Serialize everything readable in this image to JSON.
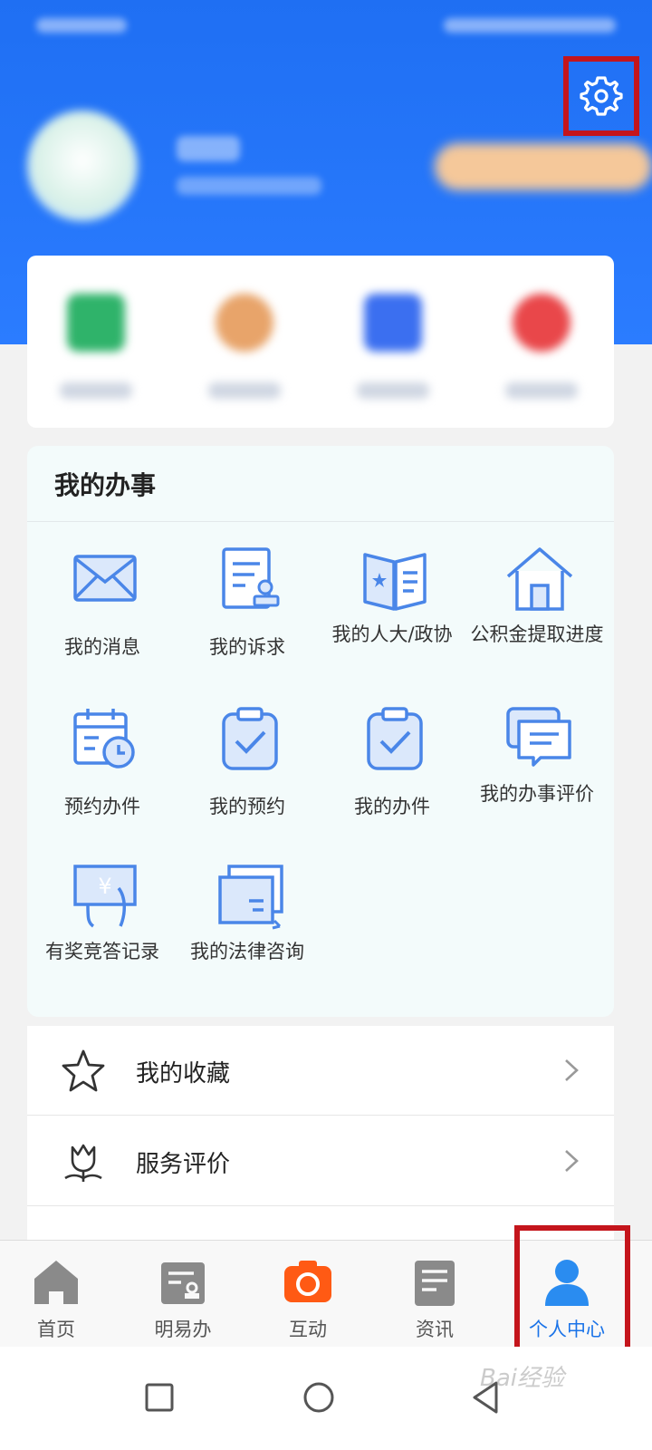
{
  "affairs": {
    "title": "我的办事",
    "items": [
      {
        "label": "我的消息",
        "icon": "envelope-icon"
      },
      {
        "label": "我的诉求",
        "icon": "document-stamp-icon"
      },
      {
        "label": "我的人大/政协",
        "icon": "open-book-icon"
      },
      {
        "label": "公积金提取进度",
        "icon": "house-icon"
      },
      {
        "label": "预约办件",
        "icon": "calendar-clock-icon"
      },
      {
        "label": "我的预约",
        "icon": "clipboard-check-icon"
      },
      {
        "label": "我的办件",
        "icon": "clipboard-check-icon"
      },
      {
        "label": "我的办事评价",
        "icon": "chat-bubbles-icon"
      },
      {
        "label": "有奖竞答记录",
        "icon": "prize-hand-icon"
      },
      {
        "label": "我的法律咨询",
        "icon": "card-window-icon"
      }
    ]
  },
  "list": [
    {
      "label": "我的收藏",
      "icon": "star-icon"
    },
    {
      "label": "服务评价",
      "icon": "tulip-icon"
    }
  ],
  "tabs": [
    {
      "label": "首页",
      "icon": "home-icon",
      "active": false
    },
    {
      "label": "明易办",
      "icon": "stamp-board-icon",
      "active": false
    },
    {
      "label": "互动",
      "icon": "camera-icon",
      "active": false
    },
    {
      "label": "资讯",
      "icon": "newspaper-icon",
      "active": false
    },
    {
      "label": "个人中心",
      "icon": "person-icon",
      "active": true
    }
  ],
  "watermark": "Bai经验",
  "colors": {
    "header_blue": "#1f6ff3",
    "highlight_red": "#c4151c",
    "icon_blue": "#4a86e8",
    "active_tab": "#1a73e8",
    "camera_orange": "#ff5a14"
  }
}
